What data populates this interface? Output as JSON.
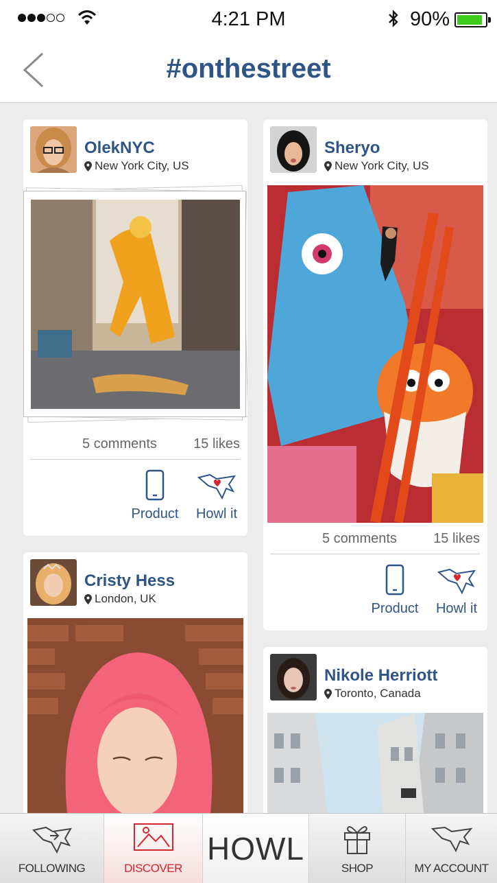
{
  "status_bar": {
    "time": "4:21 PM",
    "battery_percent": "90%",
    "signal_bars": 3,
    "signal_max": 5,
    "battery_level": 0.9
  },
  "header": {
    "title": "#onthestreet",
    "back_icon": "chevron-left-icon"
  },
  "posts": [
    {
      "user": "OlekNYC",
      "location": "New York City, US",
      "comments": "5 comments",
      "likes": "15 likes",
      "product_label": "Product",
      "howl_label": "Howl it"
    },
    {
      "user": "Sheryo",
      "location": "New York City, US",
      "comments": "5 comments",
      "likes": "15 likes",
      "product_label": "Product",
      "howl_label": "Howl it"
    },
    {
      "user": "Cristy Hess",
      "location": "London, UK"
    },
    {
      "user": "Nikole Herriott",
      "location": "Toronto, Canada"
    }
  ],
  "tab_bar": {
    "tabs": [
      {
        "label": "FOLLOWING",
        "icon": "wolf-arrow-icon"
      },
      {
        "label": "DISCOVER",
        "icon": "picture-icon",
        "active": true
      },
      {
        "label": "HOWL"
      },
      {
        "label": "SHOP",
        "icon": "gift-icon"
      },
      {
        "label": "MY ACCOUNT",
        "icon": "wolf-head-icon"
      }
    ]
  },
  "colors": {
    "accent_blue": "#2f5587",
    "active_red": "#d3262e",
    "battery_green": "#3fcc1f",
    "background": "#ececec"
  }
}
